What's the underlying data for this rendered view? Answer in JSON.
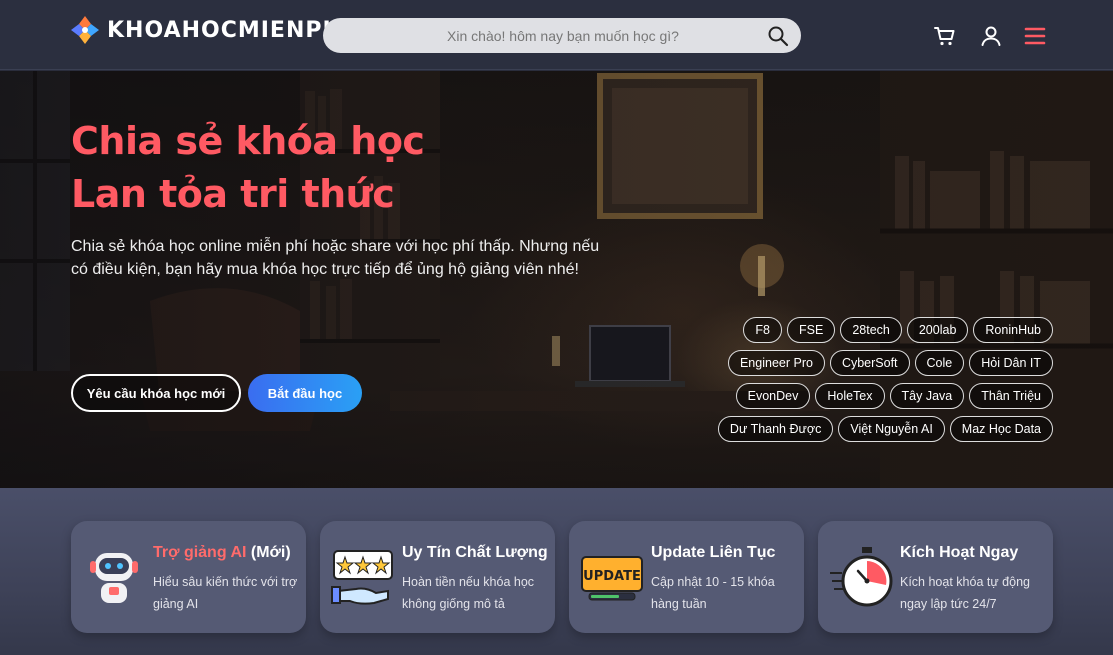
{
  "header": {
    "logo_text": "KHOAHOCMIENPHI",
    "search_placeholder": "Xin chào! hôm nay bạn muốn học gì?",
    "icons": [
      "search-icon",
      "cart-icon",
      "user-icon",
      "menu-icon"
    ],
    "accent_color": "#ff5a63"
  },
  "hero": {
    "title_line1": "Chia sẻ khóa học",
    "title_line2": "Lan tỏa tri thức",
    "description": "Chia sẻ khóa học online miễn phí hoặc share với học phí thấp. Nhưng nếu có điều kiện, bạn hãy mua khóa học trực tiếp để ủng hộ giảng viên nhé!",
    "request_button": "Yêu cầu khóa học mới",
    "start_button": "Bắt đầu học",
    "tags": [
      [
        "F8",
        "FSE",
        "28tech",
        "200lab",
        "RoninHub"
      ],
      [
        "Engineer Pro",
        "CyberSoft",
        "Cole",
        "Hỏi Dân IT"
      ],
      [
        "EvonDev",
        "HoleTex",
        "Tây Java",
        "Thân Triệu"
      ],
      [
        "Dư Thanh Được",
        "Việt Nguyễn AI",
        "Maz Học Data"
      ]
    ]
  },
  "features": [
    {
      "title_accent": "Trợ giảng AI",
      "title_rest": " (Mới)",
      "desc": "Hiểu sâu kiến thức với trợ giảng AI",
      "icon": "robot-icon"
    },
    {
      "title_accent": "",
      "title_rest": "Uy Tín Chất Lượng",
      "desc": "Hoàn tiền nếu khóa học không giống mô tả",
      "icon": "rating-hand-icon"
    },
    {
      "title_accent": "",
      "title_rest": "Update Liên Tục",
      "desc": "Cập nhật 10 - 15 khóa hàng tuần",
      "icon": "update-icon"
    },
    {
      "title_accent": "",
      "title_rest": "Kích Hoạt Ngay",
      "desc": "Kích hoạt khóa tự động ngay lập tức 24/7",
      "icon": "stopwatch-icon"
    }
  ]
}
